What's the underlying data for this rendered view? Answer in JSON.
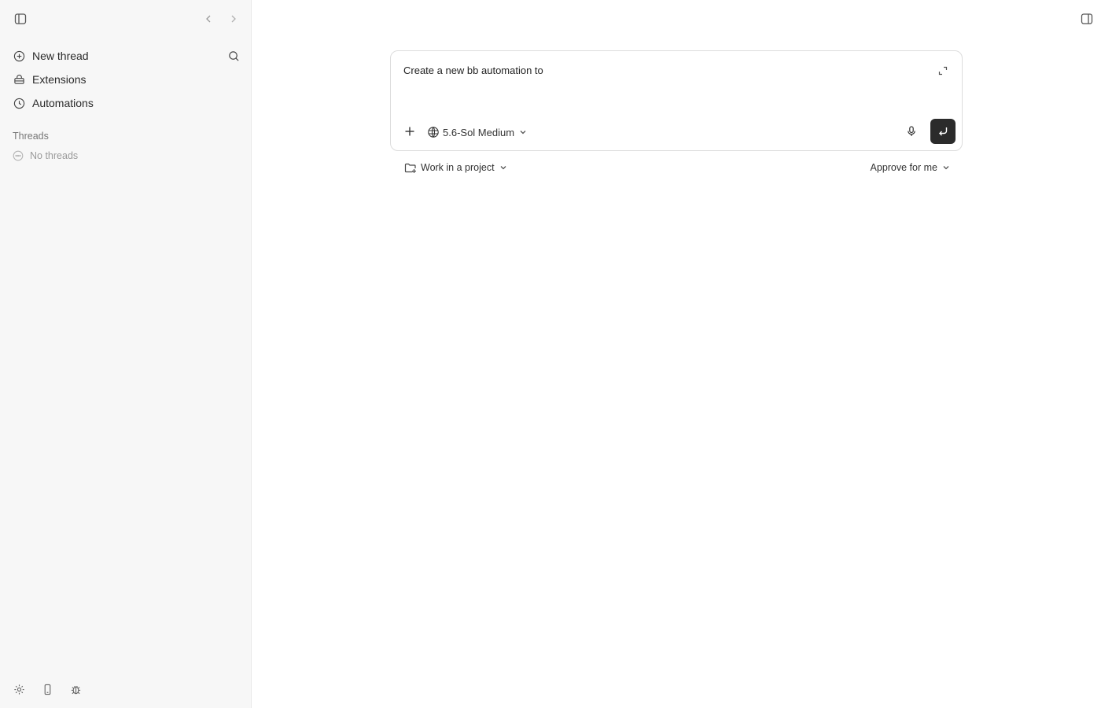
{
  "sidebar": {
    "items": [
      {
        "label": "New thread",
        "icon": "plus-circle-icon"
      },
      {
        "label": "Extensions",
        "icon": "extensions-icon"
      },
      {
        "label": "Automations",
        "icon": "clock-icon"
      }
    ],
    "threads_title": "Threads",
    "no_threads_label": "No threads"
  },
  "composer": {
    "text": "Create a new bb automation to",
    "model_label": "5.6-Sol Medium"
  },
  "footer": {
    "project_label": "Work in a project",
    "approve_label": "Approve for me"
  }
}
